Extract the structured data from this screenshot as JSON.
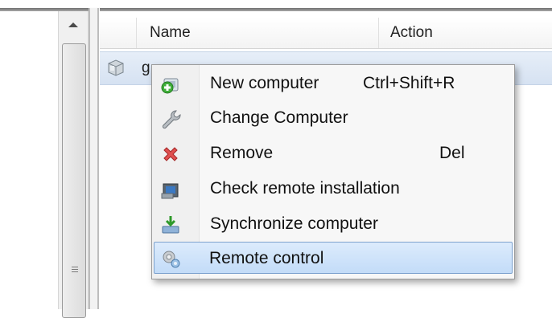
{
  "list": {
    "columns": [
      {
        "label": ""
      },
      {
        "label": "Name"
      },
      {
        "label": "Action"
      }
    ],
    "rows": [
      {
        "name": "g",
        "icon": "computer-icon"
      }
    ]
  },
  "context_menu": {
    "items": [
      {
        "label": "New computer",
        "shortcut": "Ctrl+Shift+R",
        "icon": "new-computer-icon"
      },
      {
        "label": "Change Computer",
        "shortcut": "",
        "icon": "wrench-icon"
      },
      {
        "label": "Remove",
        "shortcut": "Del",
        "icon": "remove-icon"
      },
      {
        "label": "Check remote installation",
        "shortcut": "",
        "icon": "check-installation-icon"
      },
      {
        "label": "Synchronize computer",
        "shortcut": "",
        "icon": "synchronize-icon"
      },
      {
        "label": "Remote control",
        "shortcut": "",
        "icon": "remote-control-icon",
        "highlighted": true
      }
    ]
  },
  "colors": {
    "selection": "#c3dcf8",
    "selection_border": "#7da2ce",
    "menu_bg": "#f7f7f7"
  }
}
